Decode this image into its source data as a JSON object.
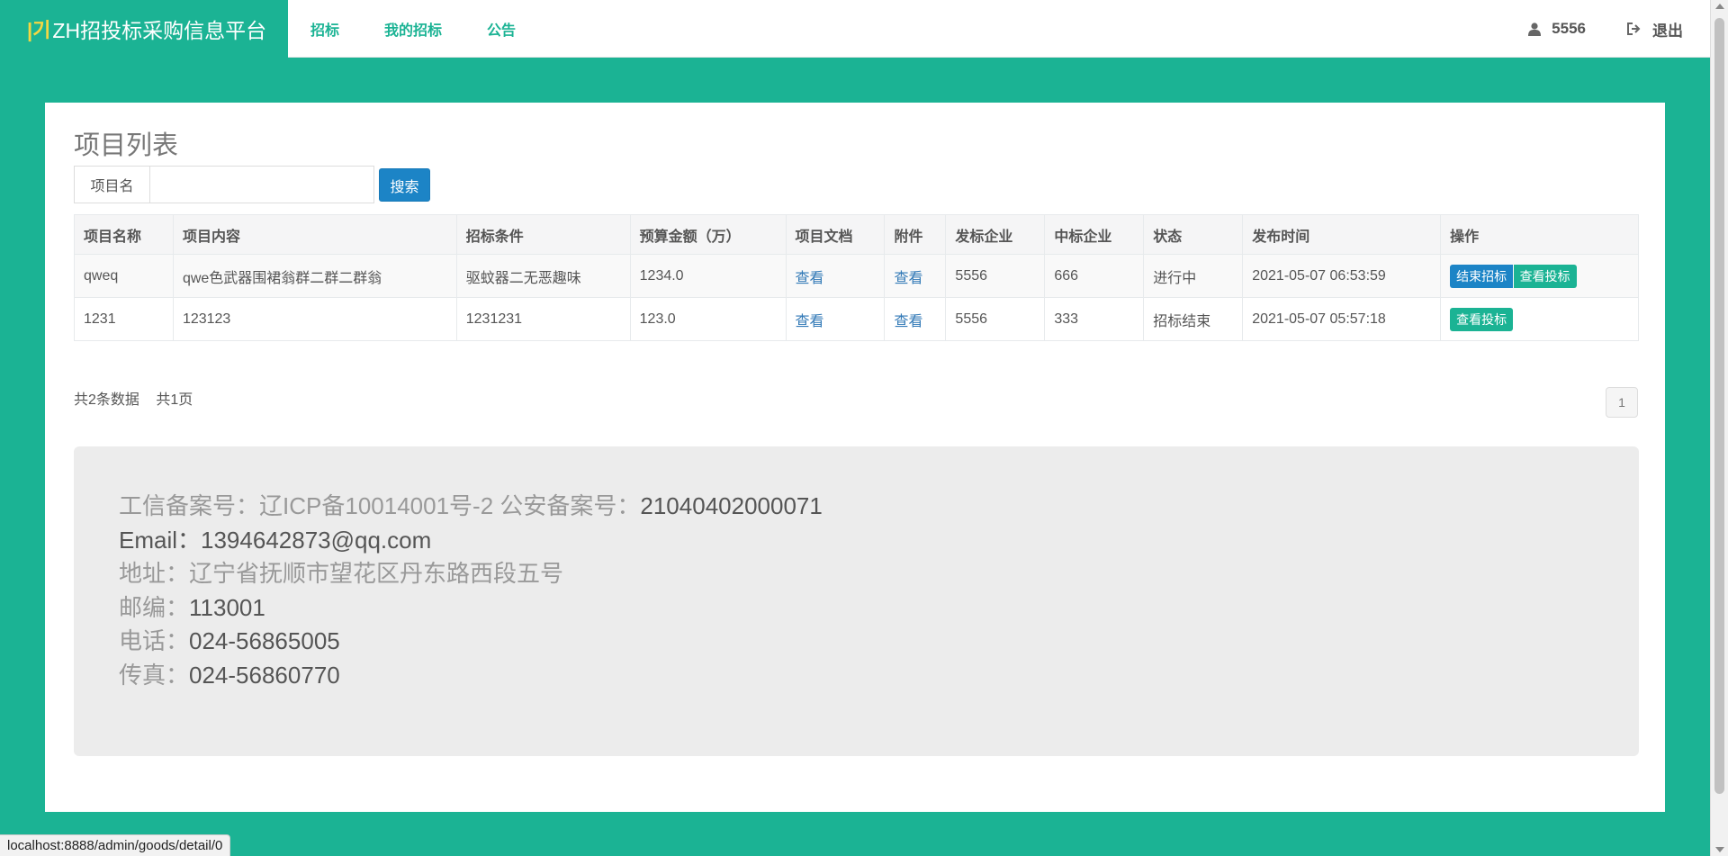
{
  "brand": {
    "logo": "|기",
    "name": "ZH招投标采购信息平台"
  },
  "nav": {
    "items": [
      "招标",
      "我的招标",
      "公告"
    ]
  },
  "user": {
    "name": "5556",
    "logout": "退出",
    "user_icon": "user-icon",
    "logout_icon": "sign-out-icon"
  },
  "page": {
    "title": "项目列表"
  },
  "search": {
    "label": "项目名",
    "value": "",
    "placeholder": "",
    "button": "搜索"
  },
  "table": {
    "headers": [
      "项目名称",
      "项目内容",
      "招标条件",
      "预算金额（万）",
      "项目文档",
      "附件",
      "发标企业",
      "中标企业",
      "状态",
      "发布时间",
      "操作"
    ],
    "rows": [
      {
        "name": "qweq",
        "content": "qwe色武器围裙翁群二群二群翁",
        "condition": "驱蚊器二无恶趣味",
        "budget": "1234.0",
        "doc": "查看",
        "attach": "查看",
        "issuer": "5556",
        "winner": "666",
        "status": "进行中",
        "time": "2021-05-07 06:53:59",
        "actions": [
          "结束招标",
          "查看投标"
        ]
      },
      {
        "name": "1231",
        "content": "123123",
        "condition": "1231231",
        "budget": "123.0",
        "doc": "查看",
        "attach": "查看",
        "issuer": "5556",
        "winner": "333",
        "status": "招标结束",
        "time": "2021-05-07 05:57:18",
        "actions": [
          "查看投标"
        ]
      }
    ]
  },
  "summary": {
    "total": "共2条数据",
    "pages": "共1页"
  },
  "pagination": {
    "current": "1"
  },
  "footer": {
    "icp_label": "工信备案号：",
    "icp_value": "辽ICP备10014001号-2",
    "police_label": " 公安备案号：",
    "police_value": "21040402000071",
    "email_label": "Email：",
    "email_value": "1394642873@qq.com",
    "addr_label": "地址：辽宁省抚顺市望花区丹东路西段五号",
    "zip_label": "邮编：",
    "zip_value": "113001",
    "tel_label": "电话：",
    "tel_value": "024-56865005",
    "fax_label": "传真：",
    "fax_value": "024-56860770"
  },
  "statusbar": {
    "url": "localhost:8888/admin/goods/detail/0"
  },
  "colors": {
    "primary": "#1bb394",
    "blue": "#1c84c6",
    "link": "#337ab7"
  }
}
